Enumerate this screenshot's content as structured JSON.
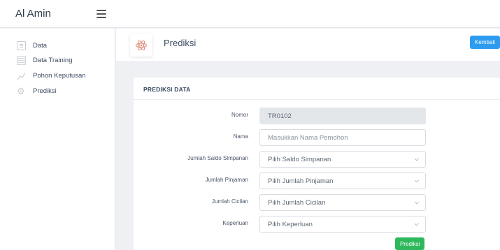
{
  "app": {
    "brand": "Al Amin"
  },
  "sidebar": {
    "items": [
      {
        "label": "Data",
        "icon": "document-icon"
      },
      {
        "label": "Data Training",
        "icon": "table-icon"
      },
      {
        "label": "Pohon Keputusan",
        "icon": "chart-line-icon"
      },
      {
        "label": "Prediksi",
        "icon": "gear-icon"
      }
    ]
  },
  "header": {
    "title": "Prediksi",
    "icon": "atom-icon",
    "back_label": "Kembali"
  },
  "card": {
    "title": "PREDIKSI DATA",
    "fields": [
      {
        "label": "Nomor",
        "value": "TR0102",
        "type": "readonly"
      },
      {
        "label": "Nama",
        "placeholder": "Masukkan Nama Pemohon",
        "type": "text"
      },
      {
        "label": "Jumlah Saldo Simpanan",
        "selected": "Pilih Saldo Simpanan",
        "type": "select"
      },
      {
        "label": "Jumlah Pinjaman",
        "selected": "Pilih Jumlah Pinjaman",
        "type": "select"
      },
      {
        "label": "Jumlah Cicilan",
        "selected": "Pilih Jumlah Cicilan",
        "type": "select"
      },
      {
        "label": "Keperluan",
        "selected": "Pilih Keperluan",
        "type": "select"
      }
    ],
    "submit_label": "Prediksi"
  },
  "colors": {
    "primary": "#2d9cf0",
    "success": "#2eb85c",
    "accent_icon": "#e08b7a"
  }
}
